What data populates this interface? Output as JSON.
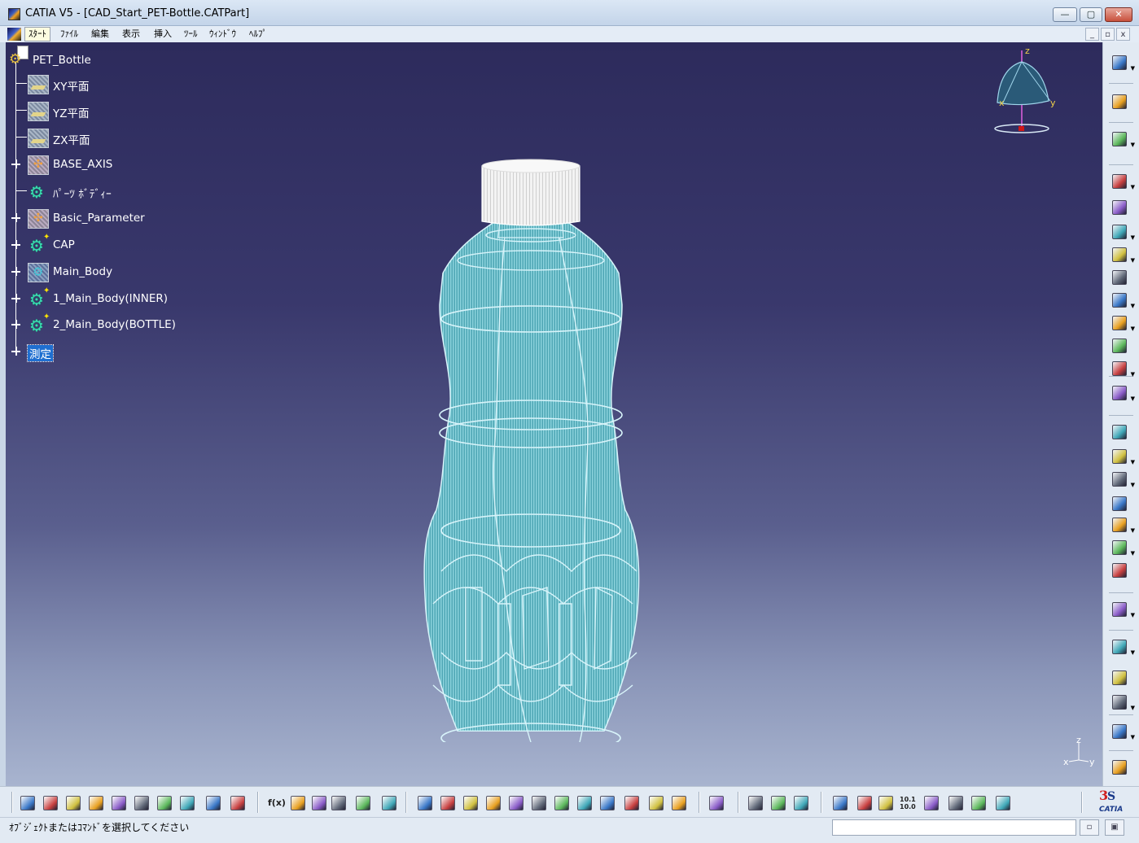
{
  "window": {
    "title": "CATIA V5 - [CAD_Start_PET-Bottle.CATPart]",
    "buttons": {
      "minimize": "—",
      "maximize": "▢",
      "close": "✕"
    }
  },
  "menubar": {
    "items": [
      "ｽﾀｰﾄ",
      "ﾌｧｲﾙ",
      "編集",
      "表示",
      "挿入",
      "ﾂｰﾙ",
      "ｳｨﾝﾄﾞｳ",
      "ﾍﾙﾌﾟ"
    ],
    "mdi_buttons": [
      "_",
      "▫",
      "x"
    ]
  },
  "tree": {
    "root": {
      "label": "PET_Bottle",
      "icon": "part-icon"
    },
    "items": [
      {
        "label": "XY平面",
        "icon": "plane-icon",
        "expandable": false
      },
      {
        "label": "YZ平面",
        "icon": "plane-icon",
        "expandable": false
      },
      {
        "label": "ZX平面",
        "icon": "plane-icon",
        "expandable": false
      },
      {
        "label": "BASE_AXIS",
        "icon": "geometrical-set-icon",
        "expandable": true
      },
      {
        "label": "ﾊﾟｰﾂ ﾎﾞﾃﾞｨｰ",
        "icon": "part-body-icon",
        "expandable": false
      },
      {
        "label": "Basic_Parameter",
        "icon": "geometrical-set-icon",
        "expandable": true
      },
      {
        "label": "CAP",
        "icon": "body-icon",
        "expandable": true
      },
      {
        "label": "Main_Body",
        "icon": "geometrical-set-icon",
        "expandable": true
      },
      {
        "label": "1_Main_Body(INNER)",
        "icon": "body-icon",
        "expandable": true
      },
      {
        "label": "2_Main_Body(BOTTLE)",
        "icon": "body-icon",
        "expandable": true
      },
      {
        "label": "測定",
        "icon": "measure-icon",
        "expandable": true,
        "selected": true
      }
    ]
  },
  "compass": {
    "x": "x",
    "y": "y",
    "z": "z"
  },
  "mini_axis": {
    "x": "x",
    "y": "y",
    "z": "z"
  },
  "right_toolbar": {
    "icons": [
      "sketcher-icon",
      "select-arrow-icon",
      "sketch-icon",
      "pad-icon",
      "pocket-icon",
      "shaft-icon",
      "groove-icon",
      "hole-icon",
      "rib-icon",
      "slot-icon",
      "stiffener-icon",
      "multi-section-solid-icon",
      "removed-multi-section-icon",
      "edge-fillet-icon",
      "chamfer-icon",
      "draft-icon",
      "shell-icon",
      "thread-icon",
      "remove-face-icon",
      "rectangular-pattern-icon",
      "boolean-icon",
      "transformation-icon",
      "mirror-icon",
      "constraint-icon",
      "scale-icon",
      "fit-all-icon"
    ]
  },
  "bottom_toolbar": {
    "icons": [
      "new-icon",
      "open-icon",
      "save-icon",
      "print-icon",
      "cut-icon",
      "copy-icon",
      "paste-icon",
      "undo-icon",
      "redo-icon",
      "whats-this-icon",
      "formula-icon",
      "comment-icon",
      "link-icon",
      "table-icon",
      "lock-icon",
      "catalog-icon",
      "fly-mode-icon",
      "fit-all-icon",
      "pan-icon",
      "rotate-icon",
      "zoom-in-icon",
      "zoom-out-icon",
      "normal-view-icon",
      "multi-view-icon",
      "iso-view-icon",
      "shading-icon",
      "hide-show-icon",
      "swap-space-icon",
      "capture-icon",
      "measure-between-icon",
      "measure-item-icon",
      "measure-inertia-icon",
      "update-icon",
      "apply-material-icon",
      "axis-system-icon",
      "units-icon",
      "3d-compass-icon",
      "analysis-icon",
      "parameters-icon",
      "layer-icon"
    ],
    "formula_label": "f(x)",
    "units_label": "10.1 10.0"
  },
  "statusbar": {
    "message": "ｵﾌﾞｼﾞｪｸﾄまたはｺﾏﾝﾄﾞを選択してください",
    "command_value": ""
  },
  "colors": {
    "viewport_top": "#2d2b5c",
    "viewport_bottom": "#a8b4cf",
    "bottle_fill": "#5fb3bf",
    "bottle_wire": "#d8f4fa",
    "cap": "#f2f2f2",
    "tree_text": "#ffffff",
    "selection": "#1f6fd0"
  }
}
